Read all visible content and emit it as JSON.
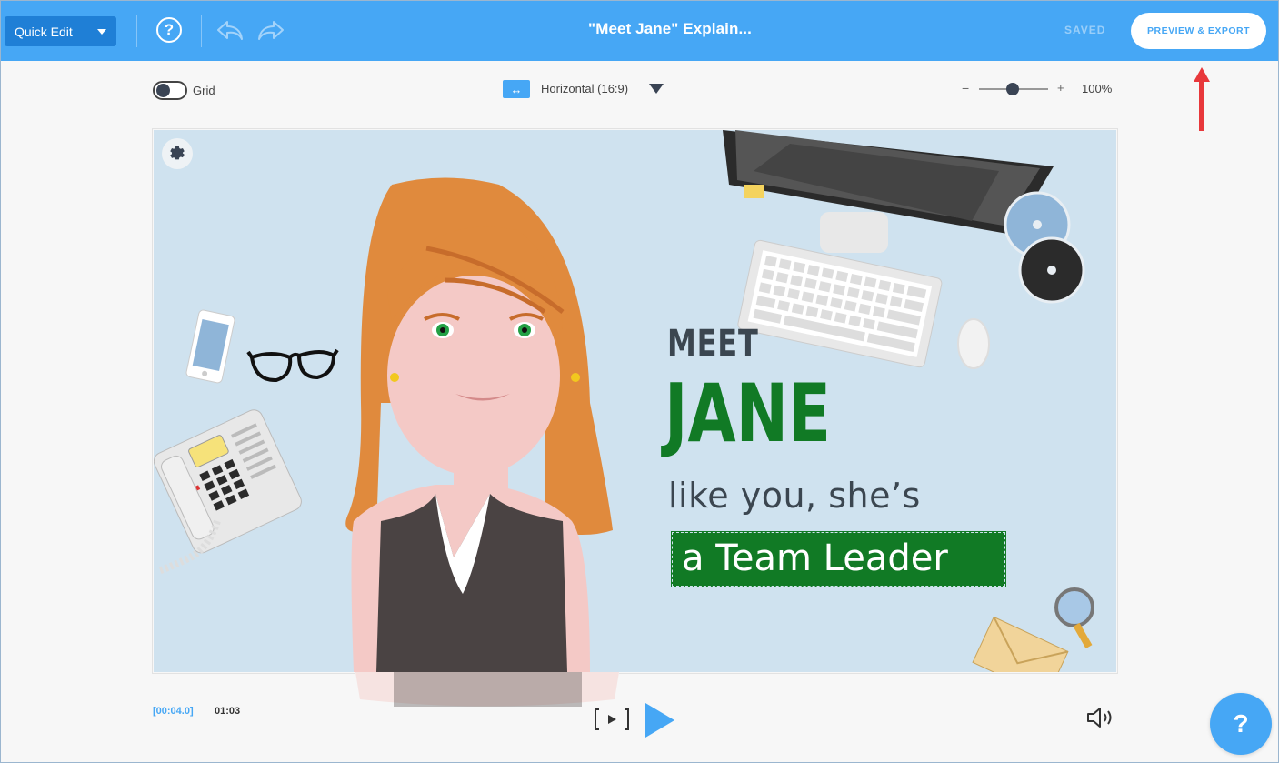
{
  "header": {
    "mode_label": "Quick Edit",
    "help_glyph": "?",
    "title": "\"Meet Jane\" Explain...",
    "save_status": "SAVED",
    "preview_label": "PREVIEW & EXPORT"
  },
  "toolbar": {
    "grid_label": "Grid",
    "grid_enabled": false,
    "orientation_icon": "↔",
    "orientation_label": "Horizontal (16:9)",
    "zoom_minus": "−",
    "zoom_plus": "+",
    "zoom_value": "100%",
    "zoom_level": 1.0
  },
  "scene": {
    "line1": "MEET",
    "line2": "JANE",
    "line3": "like you, she’s",
    "line4": "a Team Leader"
  },
  "player": {
    "current_time": "[00:04.0]",
    "total_time": "01:03"
  },
  "help_fab": "?",
  "colors": {
    "accent": "#46a7f5",
    "highlight_green": "#117a25",
    "canvas_bg": "#cfe2ef",
    "annotation_arrow": "#e8383b"
  }
}
